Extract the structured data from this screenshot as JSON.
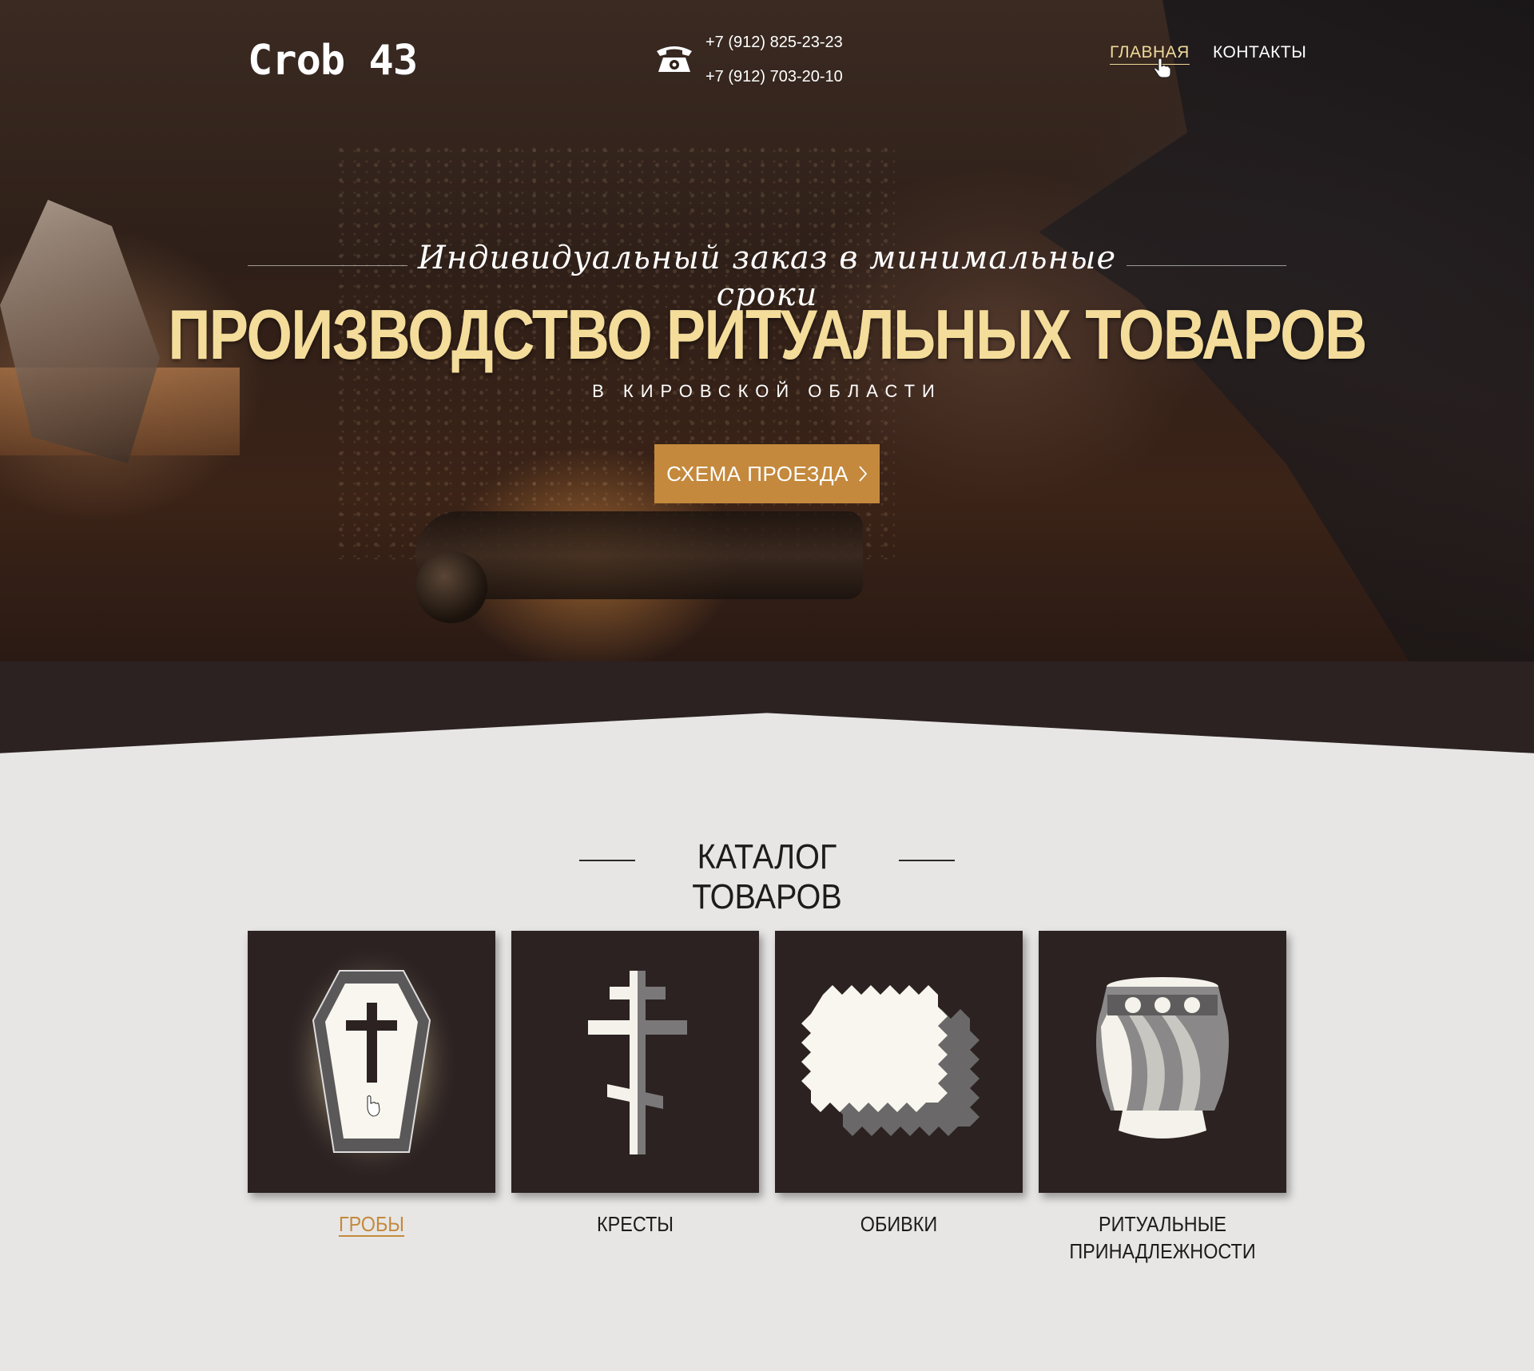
{
  "header": {
    "logo": "Crob 43",
    "phones": [
      "+7 (912) 825-23-23",
      "+7 (912) 703-20-10"
    ],
    "nav": {
      "home": "Главная",
      "contacts": "Контакты"
    }
  },
  "hero": {
    "tagline": "Индивидуальный заказ  в минимальные  сроки",
    "title": "ПРОИЗВОДСТВО РИТУАЛЬНЫХ ТОВАРОВ",
    "subtitle": "В КИРОВСКОЙ ОБЛАСТИ",
    "button_label": "СХЕМА ПРОЕЗДА"
  },
  "catalog": {
    "title": "КАТАЛОГ ТОВАРОВ",
    "items": [
      {
        "label": "Гробы",
        "icon": "coffin-icon",
        "active": true
      },
      {
        "label": "Кресты",
        "icon": "cross-icon",
        "active": false
      },
      {
        "label": "Обивки",
        "icon": "fabric-icon",
        "active": false
      },
      {
        "label": "Ритуальные принадлежности",
        "icon": "vase-icon",
        "active": false
      }
    ]
  },
  "colors": {
    "accent": "#c4893d",
    "title_gold": "#f4dc9b",
    "dark": "#2c2222",
    "page_bg": "#e7e6e4"
  }
}
